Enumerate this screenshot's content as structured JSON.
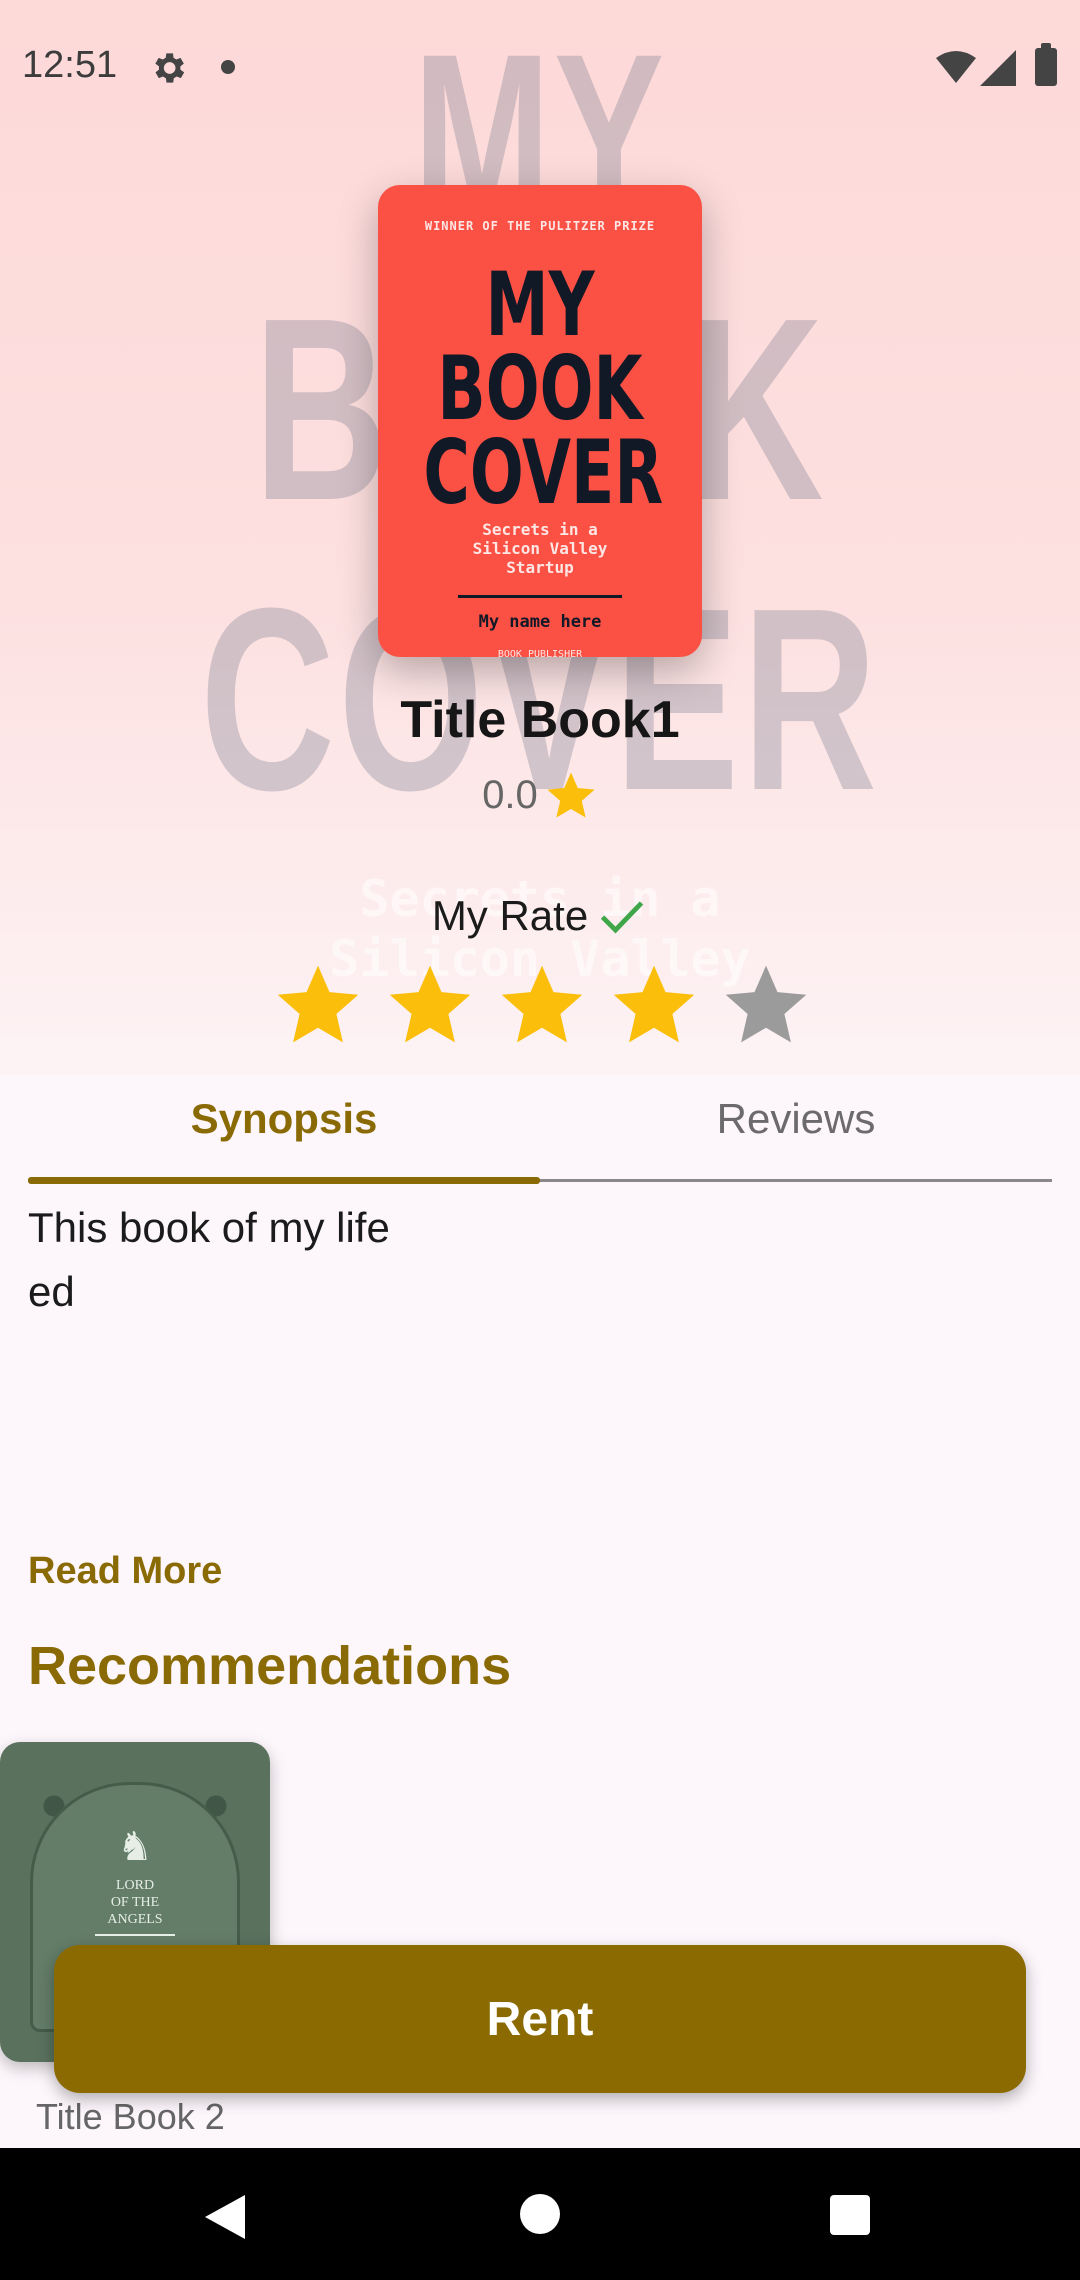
{
  "status_bar": {
    "time": "12:51"
  },
  "cover": {
    "prize": "WINNER OF THE PULITZER PRIZE",
    "title_lines": [
      "MY",
      "BOOK",
      "COVER"
    ],
    "subtitle_lines": [
      "Secrets in a",
      "Silicon Valley",
      "Startup"
    ],
    "author": "My name here",
    "publisher": "BOOK PUBLISHER"
  },
  "background_text": {
    "lines": [
      "MY",
      "BOOK",
      "COVER"
    ],
    "sub_lines": [
      "Secrets in a",
      "Silicon Valley"
    ]
  },
  "book": {
    "title": "Title Book1",
    "rating": "0.0"
  },
  "my_rate": {
    "label": "My Rate",
    "value": 4,
    "max": 5
  },
  "colors": {
    "accent": "#8b6a02",
    "star": "#fbbf0b",
    "star_empty": "#9b9b9b",
    "check": "#3fa64a"
  },
  "tabs": {
    "synopsis": "Synopsis",
    "reviews": "Reviews",
    "selected": "Synopsis"
  },
  "synopsis": {
    "text": "This book of my life ed"
  },
  "read_more": "Read More",
  "recommendations": {
    "heading": "Recommendations",
    "items": [
      {
        "title": "Title Book 2",
        "cover_text": [
          "LORD",
          "OF THE",
          "ANGELS"
        ]
      }
    ]
  },
  "rent_button": "Rent"
}
